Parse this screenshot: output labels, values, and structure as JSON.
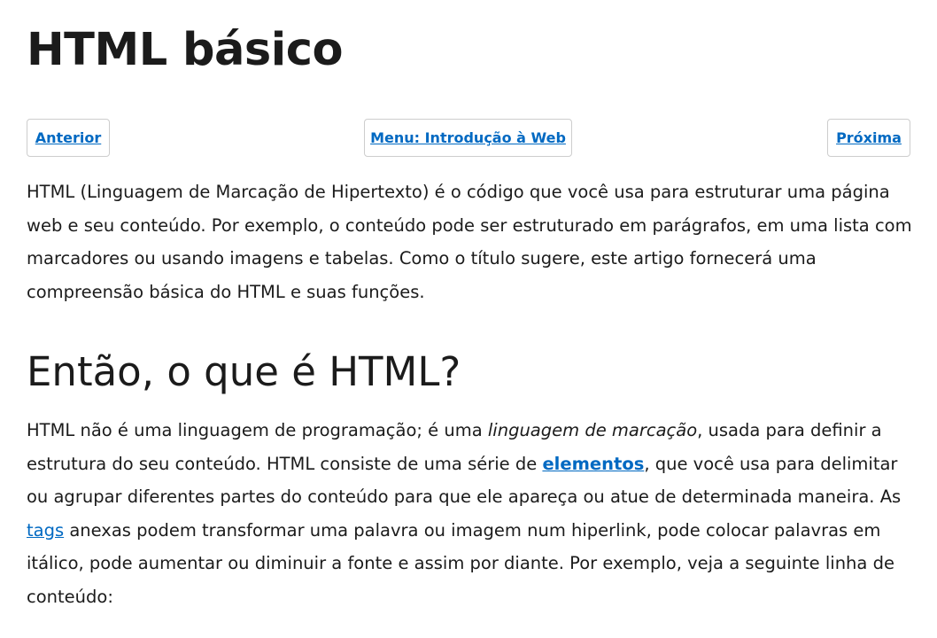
{
  "title": "HTML básico",
  "nav": {
    "previous": "Anterior",
    "menu": "Menu: Introdução à Web",
    "next": "Próxima"
  },
  "intro": "HTML (Linguagem de Marcação de Hipertexto) é o código que você usa para estruturar uma página web e seu conteúdo. Por exemplo, o conteúdo pode ser estruturado em parágrafos, em uma lista com marcadores ou usando imagens e tabelas. Como o título sugere, este artigo fornecerá uma compreensão básica do HTML e suas funções.",
  "section": {
    "heading": "Então, o que é HTML?",
    "p_part1": "HTML não é uma linguagem de programação; é uma ",
    "p_em": "linguagem de marcação",
    "p_part2": ", usada para definir a estrutura do seu conteúdo. HTML consiste de uma série de ",
    "link_elements": "elementos",
    "p_part3": ", que você usa para delimitar ou agrupar diferentes partes do conteúdo para que ele apareça ou atue de determinada maneira. As ",
    "link_tags": "tags",
    "p_part4": " anexas podem transformar uma palavra ou imagem num hiperlink, pode colocar palavras em itálico, pode aumentar ou diminuir a fonte e assim por diante. Por exemplo, veja a seguinte linha de conteúdo:"
  },
  "colors": {
    "link": "#0069c2",
    "text": "#1b1b1b",
    "border": "#cdcdcd"
  }
}
